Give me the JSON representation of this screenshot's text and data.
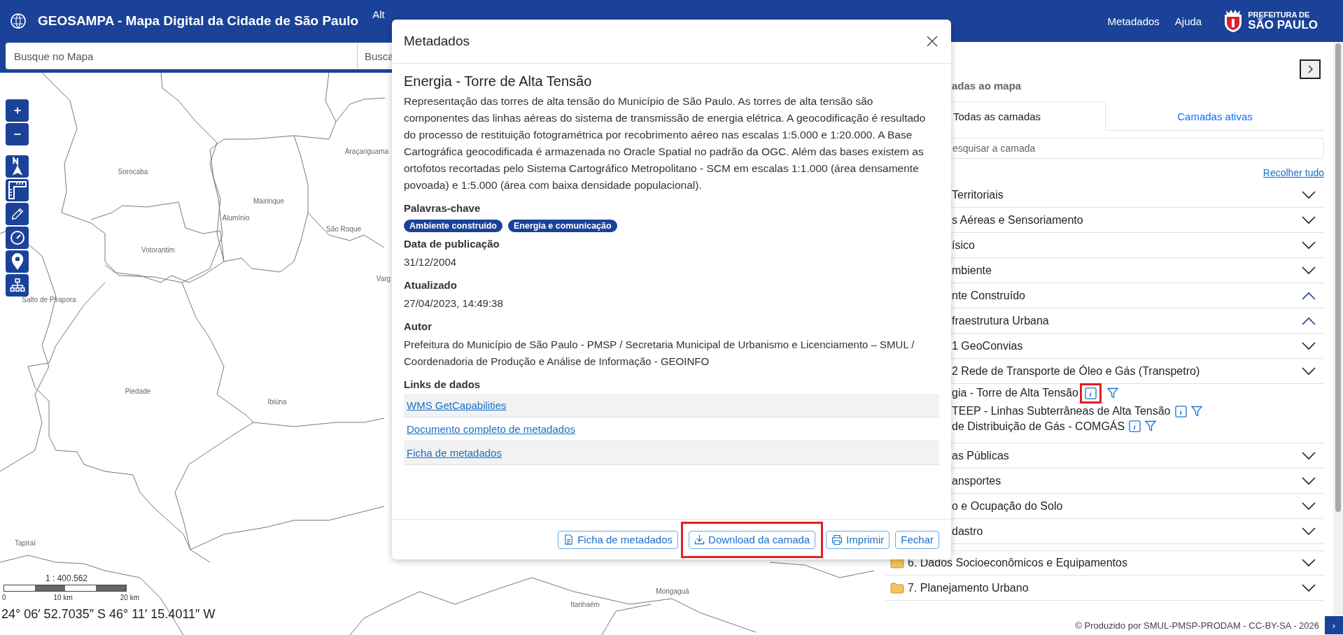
{
  "header": {
    "title": "GEOSAMPA - Mapa Digital da Cidade de São Paulo",
    "nav_partial": "Alt",
    "links": [
      "Metadados",
      "Ajuda"
    ],
    "logo": {
      "line_1": "PREFEITURA DE",
      "line_2": "SÃO PAULO"
    }
  },
  "search": {
    "placeholder": "Busque no Mapa",
    "second_placeholder": "Busca"
  },
  "map": {
    "places": [
      "Sorocaba",
      "Araçariguama",
      "Mairinque",
      "Alumínio",
      "São Roque",
      "Votorantim",
      "Varg",
      "Salto de Pirapora",
      "Piedade",
      "Ibiúna",
      "Tapiraí",
      "Itanhaém",
      "Mongaguá"
    ],
    "scale": "1 : 400.562",
    "scale_ticks": [
      "0",
      "10 km",
      "20 km"
    ],
    "coordinates": "24° 06′ 52.7035″ S 46° 11′ 15.4011″ W"
  },
  "dialog": {
    "title": "Metadados",
    "layer_title": "Energia - Torre de Alta Tensão",
    "description": "Representação das torres de alta tensão do Município de São Paulo. As torres de alta tensão são componentes das linhas aéreas do sistema de transmissão de energia elétrica. A geocodificação é resultado do processo de restituição fotogramétrica por recobrimento aéreo nas escalas 1:5.000 e 1:20.000. A Base Cartográfica geocodificada é armazenada no Oracle Spatial no padrão da OGC. Além das bases existem as ortofotos recortadas pelo Sistema Cartográfico Metropolitano - SCM em escalas 1:1.000 (área densamente povoada) e 1:5.000 (área com baixa densidade populacional).",
    "sections": [
      {
        "heading": "Palavras-chave",
        "kind": "tags",
        "tags": [
          "Ambiente construído",
          "Energia e comunicação"
        ]
      },
      {
        "heading": "Data de publicação",
        "kind": "text",
        "text": "31/12/2004"
      },
      {
        "heading": "Atualizado",
        "kind": "text",
        "text": "27/04/2023, 14:49:38"
      },
      {
        "heading": "Autor",
        "kind": "text",
        "text": "Prefeitura do Município de São Paulo - PMSP / Secretaria Municipal de Urbanismo e Licenciamento – SMUL / Coordenadoria de Produção e Análise de Informação - GEOINFO"
      },
      {
        "heading": "Links de dados",
        "kind": "links",
        "links": [
          "WMS GetCapabilities",
          "Documento completo de metadados",
          "Ficha de metadados"
        ]
      }
    ],
    "buttons": [
      {
        "label": "Ficha de metadados",
        "kind": "document",
        "highlighted": false
      },
      {
        "label": "Download da camada",
        "kind": "download",
        "highlighted": true
      },
      {
        "label": "Imprimir",
        "kind": "print",
        "highlighted": false
      },
      {
        "label": "Fechar",
        "kind": "plain",
        "highlighted": false
      }
    ]
  },
  "layer_panel": {
    "heading": "adas ao mapa",
    "tabs": [
      {
        "label": "Todas as camadas",
        "selected": true
      },
      {
        "label": "Camadas ativas",
        "selected": false
      }
    ],
    "search": {
      "placeholder": "esquisar a camada"
    },
    "collapse_all": "Recolher tudo",
    "groups": [
      {
        "label": "Territoriais",
        "kind": "group",
        "expanded": false
      },
      {
        "label": "s Aéreas e Sensoriamento",
        "kind": "group",
        "expanded": false
      },
      {
        "label": "ísico",
        "kind": "group",
        "expanded": false
      },
      {
        "label": "mbiente",
        "kind": "group",
        "expanded": false
      },
      {
        "label": "nte Construído",
        "kind": "group",
        "expanded": true,
        "children": [
          {
            "label": "fraestrutura Urbana",
            "kind": "group",
            "expanded": true,
            "children": [
              {
                "label": "1 GeoConvias",
                "kind": "group",
                "expanded": false
              },
              {
                "label": "2 Rede de Transporte de Óleo e Gás (Transpetro)",
                "kind": "group",
                "expanded": false
              },
              {
                "label": "gia - Torre de Alta Tensão",
                "kind": "layer",
                "highlighted": true
              },
              {
                "label": "TEEP - Linhas Subterrâneas de Alta Tensão",
                "kind": "layer",
                "highlighted": false
              },
              {
                "label": "de Distribuição de Gás - COMGÁS",
                "kind": "layer",
                "highlighted": false
              }
            ]
          },
          {
            "label": "as Públicas",
            "kind": "group",
            "expanded": false
          },
          {
            "label": "ansportes",
            "kind": "group",
            "expanded": false
          },
          {
            "label": "o e Ocupação do Solo",
            "kind": "group",
            "expanded": false
          },
          {
            "label": "dastro",
            "kind": "group",
            "expanded": false
          }
        ]
      },
      {
        "label": "6. Dados Socioeconômicos e Equipamentos",
        "kind": "group",
        "expanded": false
      },
      {
        "label": "7. Planejamento Urbano",
        "kind": "group",
        "expanded": false
      }
    ]
  },
  "footer": {
    "credit": "© Produzido por SMUL-PMSP-PRODAM - CC-BY-SA - 2026",
    "button": "›"
  }
}
